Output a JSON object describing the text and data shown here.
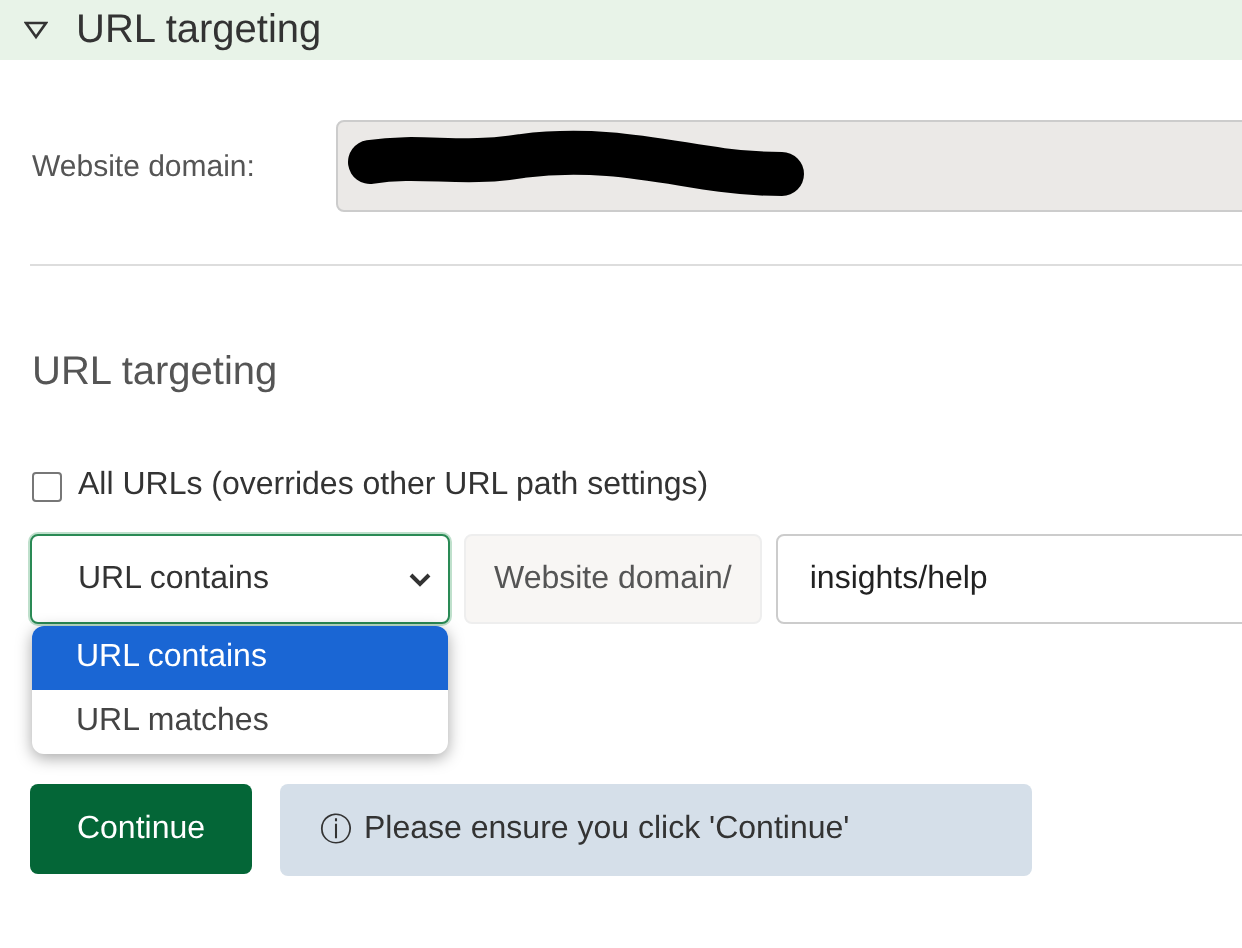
{
  "section": {
    "title": "URL targeting",
    "expanded": true
  },
  "domain": {
    "label": "Website domain:",
    "redacted": true
  },
  "targeting": {
    "heading": "URL targeting",
    "all_urls": {
      "label": "All URLs (overrides other URL path settings)",
      "checked": false
    },
    "match_select": {
      "value": "URL contains",
      "open": true,
      "options": [
        {
          "label": "URL contains",
          "selected": true
        },
        {
          "label": "URL matches",
          "selected": false
        }
      ]
    },
    "prefix": "Website domain/",
    "path": {
      "value": "insights/help"
    }
  },
  "continue_button": "Continue",
  "notice": {
    "icon": "ⓘ",
    "text": "Please ensure you click 'Continue'"
  }
}
